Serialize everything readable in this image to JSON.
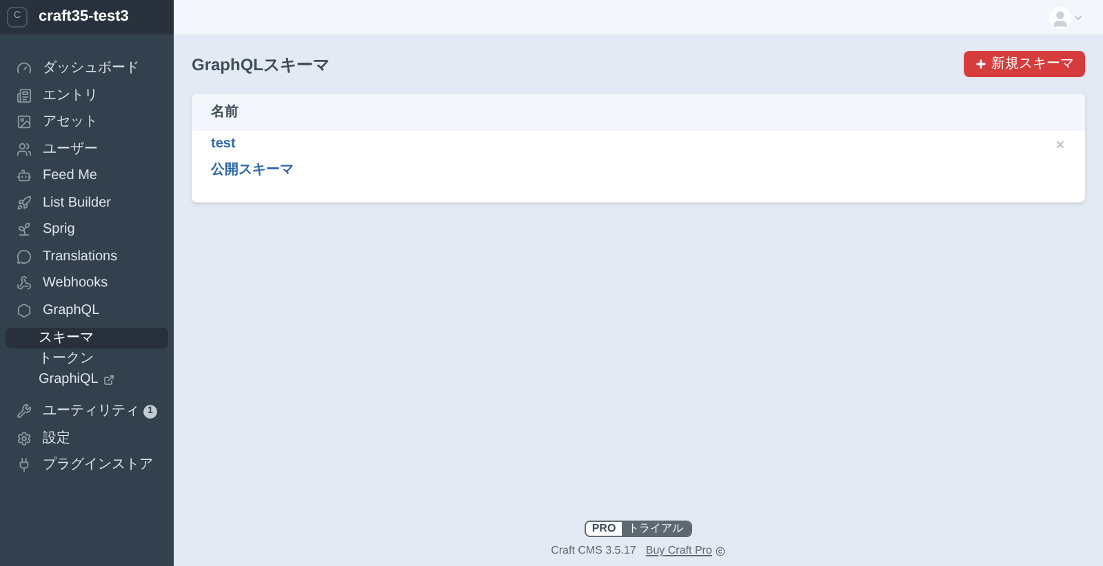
{
  "site": {
    "initial": "C",
    "name": "craft35-test3"
  },
  "nav": [
    {
      "kind": "item",
      "label": "ダッシュボード"
    },
    {
      "kind": "item",
      "label": "エントリ"
    },
    {
      "kind": "item",
      "label": "アセット"
    },
    {
      "kind": "item",
      "label": "ユーザー"
    },
    {
      "kind": "item",
      "label": "Feed Me"
    },
    {
      "kind": "item",
      "label": "List Builder"
    },
    {
      "kind": "item",
      "label": "Sprig"
    },
    {
      "kind": "item",
      "label": "Translations"
    },
    {
      "kind": "item",
      "label": "Webhooks"
    },
    {
      "kind": "item",
      "label": "GraphQL",
      "children": [
        {
          "label": "スキーマ",
          "selected": true,
          "external": false
        },
        {
          "label": "トークン",
          "selected": false,
          "external": false
        },
        {
          "label": "GraphiQL",
          "selected": false,
          "external": true
        }
      ]
    },
    {
      "kind": "item",
      "label": "ユーティリティ",
      "badge": "1"
    },
    {
      "kind": "item",
      "label": "設定"
    },
    {
      "kind": "item",
      "label": "プラグインストア"
    }
  ],
  "page": {
    "title": "GraphQLスキーマ",
    "new_button": "新規スキーマ"
  },
  "table": {
    "columns": [
      "名前"
    ],
    "rows": [
      {
        "name": "test",
        "deletable": true
      },
      {
        "name": "公開スキーマ",
        "deletable": false
      }
    ]
  },
  "footer": {
    "edition": "PRO",
    "edition_status": "トライアル",
    "version": "Craft CMS 3.5.17",
    "buy_link": "Buy Craft Pro"
  }
}
